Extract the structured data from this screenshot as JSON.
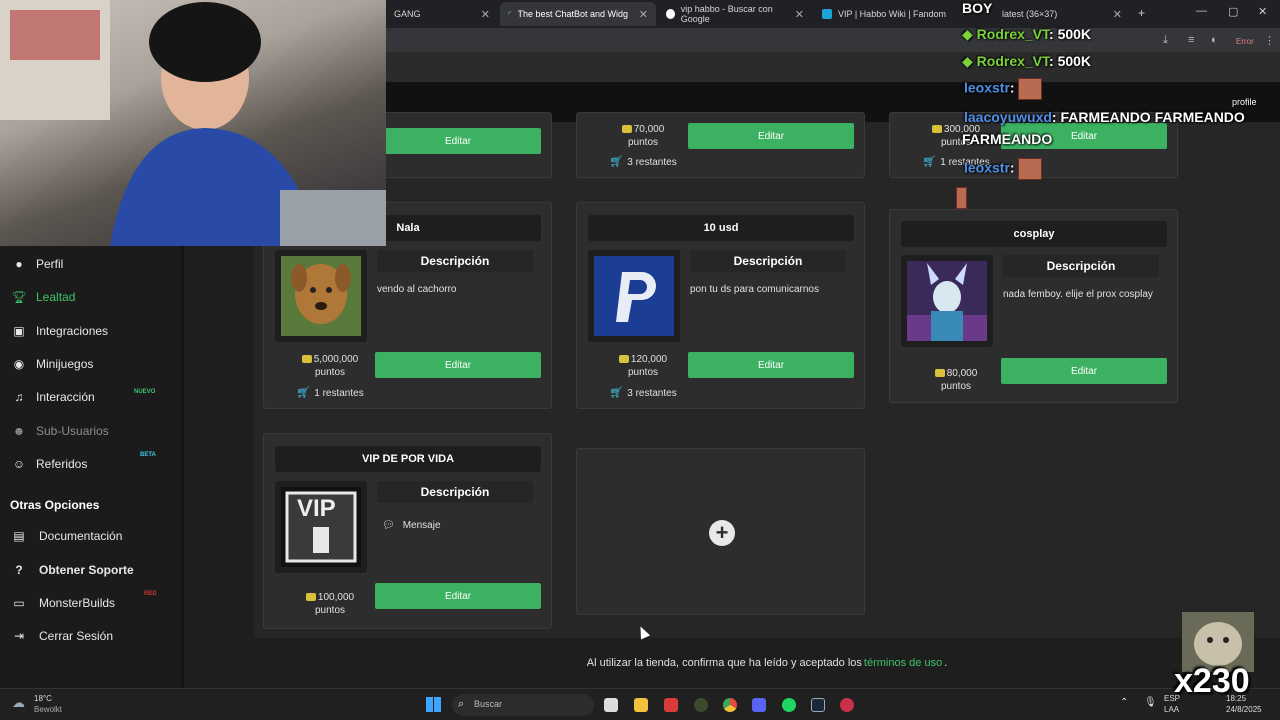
{
  "browser": {
    "tabs": [
      {
        "title": "GANG",
        "active": false
      },
      {
        "title": "The best ChatBot and Widgets",
        "active": true
      },
      {
        "title": "vip habbo - Buscar con Google",
        "active": false
      },
      {
        "title": "VIP | Habbo Wiki | Fandom",
        "active": false
      },
      {
        "title": "latest (36×37)",
        "active": false
      }
    ],
    "error_label": "Error"
  },
  "sidebar": {
    "items": [
      {
        "label": "Perfil",
        "icon": "user-icon"
      },
      {
        "label": "Lealtad",
        "icon": "trophy-icon",
        "active": true
      },
      {
        "label": "Integraciones",
        "icon": "integrations-icon"
      },
      {
        "label": "Minijuegos",
        "icon": "gamepad-icon"
      },
      {
        "label": "Interacción",
        "icon": "music-icon",
        "badge": "NUEVO"
      },
      {
        "label": "Sub-Usuarios",
        "icon": "group-icon"
      },
      {
        "label": "Referidos",
        "icon": "users-icon",
        "badge": "BETA"
      }
    ],
    "section_title": "Otras Opciones",
    "other_items": [
      {
        "label": "Documentación",
        "icon": "document-icon"
      },
      {
        "label": "Obtener Soporte",
        "icon": "help-icon"
      },
      {
        "label": "MonsterBuilds",
        "icon": "monitor-icon",
        "badge": "RED"
      },
      {
        "label": "Cerrar Sesión",
        "icon": "logout-icon"
      }
    ]
  },
  "cards": {
    "top_row": [
      {
        "price": "70,000",
        "unit": "puntos",
        "stock": "3 restantes",
        "button": "Editar"
      },
      {
        "price": "300,000",
        "unit": "puntos",
        "stock": "1 restantes",
        "button": "Editar"
      }
    ],
    "top_first_button": "Editar",
    "row1": [
      {
        "title": "Nala",
        "desc_head": "Descripción",
        "desc": "vendo al cachorro",
        "price": "5,000,000",
        "unit": "puntos",
        "stock": "1 restantes",
        "button": "Editar"
      },
      {
        "title": "10 usd",
        "desc_head": "Descripción",
        "desc": "pon tu ds para comunicarnos",
        "price": "120,000",
        "unit": "puntos",
        "stock": "3 restantes",
        "button": "Editar"
      },
      {
        "title": "cosplay",
        "desc_head": "Descripción",
        "desc": "nada femboy. elije el prox cosplay",
        "price": "80,000",
        "unit": "puntos",
        "button": "Editar"
      }
    ],
    "row2": [
      {
        "title": "VIP DE POR VIDA",
        "desc_head": "Descripción",
        "desc": "Mensaje",
        "price": "100,000",
        "unit": "puntos",
        "button": "Editar",
        "thumb_text": "VIP"
      }
    ]
  },
  "footer": {
    "text_before": "Al utilizar la tienda, confirma que ha leído y aceptado los",
    "link": "términos de uso",
    "text_after": "."
  },
  "taskbar": {
    "weather_temp": "18°C",
    "weather_desc": "Bewolkt",
    "search_placeholder": "Buscar",
    "lang_top": "ESP",
    "lang_bottom": "LAA",
    "time": "18:25",
    "date": "24/8/2025"
  },
  "chat": {
    "lines": [
      {
        "user": "BOY",
        "text": "",
        "color": "#ffffff"
      },
      {
        "user": "Rodrex_VT",
        "text": ": 500K",
        "color": "#7ad13a"
      },
      {
        "user": "Rodrex_VT",
        "text": ": 500K",
        "color": "#7ad13a"
      },
      {
        "user": "leoxstr",
        "text": ":",
        "color": "#4f8fe8"
      },
      {
        "user": "laacoyuwuxd",
        "text": ": FARMEANDO FARMEANDO",
        "color": "#4f8fe8"
      },
      {
        "user": "FARMEANDO",
        "text": "",
        "color": "#ffffff"
      },
      {
        "user": "leoxstr",
        "text": ":",
        "color": "#4f8fe8"
      }
    ],
    "profile_label": "profile"
  },
  "alert": {
    "multiplier": "x230"
  }
}
